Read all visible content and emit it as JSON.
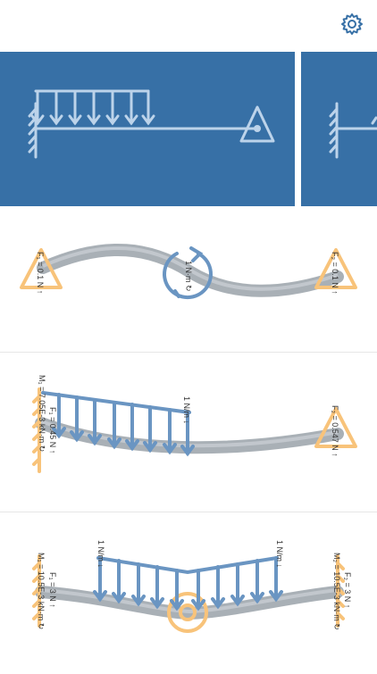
{
  "toolbar": {
    "settings_icon": "gear-icon"
  },
  "colors": {
    "card_blue": "#3770a6",
    "line_light": "#bcd3ea",
    "load_blue": "#6a95c2",
    "support_orange": "#f8c37a",
    "beam_gray": "#a8b0b7"
  },
  "examples": [
    {
      "labels": {
        "f1": "F₁ = 0.1 N ↑",
        "moment": "1 N·m ↻",
        "f2": "F₂ = 0.1 N ↑"
      }
    },
    {
      "labels": {
        "m1": "M₁ = 7.05E-3 kN·m ↻",
        "f1": "F₁ = 0.45 N ↑",
        "load_start": "1 N/m ↓",
        "load_end": "1 N/m ↓",
        "f2": "F₂ = 0.547 N ↑"
      }
    },
    {
      "labels": {
        "m1": "M₁ = 10.5E-3 kN·m ↻",
        "f1": "F₁ = 3 N ↑",
        "load_left": "1 N/m ↓",
        "load_right": "1 N/m ↓",
        "f2": "F₂ = 3 N ↑",
        "m2": "M₂ = 10.5E-3 kN·m ↻"
      }
    }
  ]
}
